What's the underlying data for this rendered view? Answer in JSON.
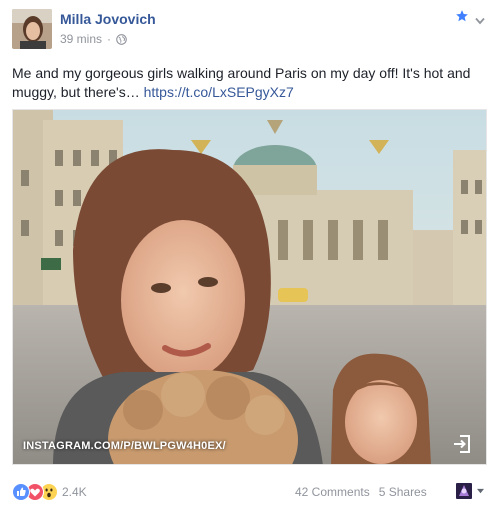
{
  "post": {
    "author": "Milla Jovovich",
    "time": "39 mins",
    "separator": "·",
    "privacy_icon": "globe-icon",
    "text": "Me and my gorgeous girls walking around Paris on my day off! It's hot and muggy, but there's… ",
    "link": "https://t.co/LxSEPgyXz7",
    "photo_caption": "INSTAGRAM.COM/P/BWLPGW4H0EX/"
  },
  "reactions": {
    "icons": [
      "like-icon",
      "love-icon",
      "wow-icon"
    ],
    "count": "2.4K"
  },
  "stats": {
    "comments": "42 Comments",
    "shares": "5 Shares"
  },
  "colors": {
    "link": "#365899",
    "meta": "#90949c",
    "text": "#1d2129",
    "like": "#5890ff",
    "love": "#f25268",
    "wow": "#fcd353"
  }
}
